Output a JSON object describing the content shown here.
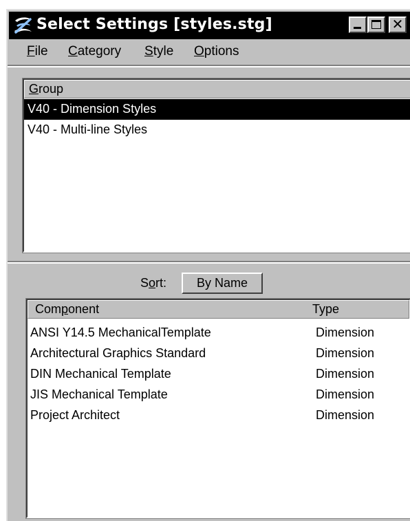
{
  "window": {
    "title": "Select Settings [styles.stg]",
    "title_bar_color": "#000000",
    "app_icon": "microstation-logo-icon"
  },
  "menubar": {
    "items": [
      {
        "accel": "F",
        "rest": "ile"
      },
      {
        "accel": "C",
        "rest": "ategory"
      },
      {
        "accel": "S",
        "rest": "tyle"
      },
      {
        "accel": "O",
        "rest": "ptions"
      }
    ]
  },
  "group_list": {
    "header_accel": "G",
    "header_rest": "roup",
    "items": [
      {
        "label": "V40 - Dimension Styles",
        "selected": true
      },
      {
        "label": "V40 - Multi-line Styles",
        "selected": false
      }
    ]
  },
  "sort": {
    "label_pre": "S",
    "label_accel": "o",
    "label_post": "rt:",
    "button_label": "By Name"
  },
  "component_list": {
    "headers": {
      "component_pre": "Com",
      "component_accel": "p",
      "component_post": "onent",
      "type": "Type"
    },
    "rows": [
      {
        "component": "ANSI Y14.5 MechanicalTemplate",
        "type": "Dimension"
      },
      {
        "component": "Architectural Graphics Standard",
        "type": "Dimension"
      },
      {
        "component": "DIN Mechanical Template",
        "type": "Dimension"
      },
      {
        "component": "JIS Mechanical Template",
        "type": "Dimension"
      },
      {
        "component": "Project Architect",
        "type": "Dimension"
      }
    ]
  }
}
